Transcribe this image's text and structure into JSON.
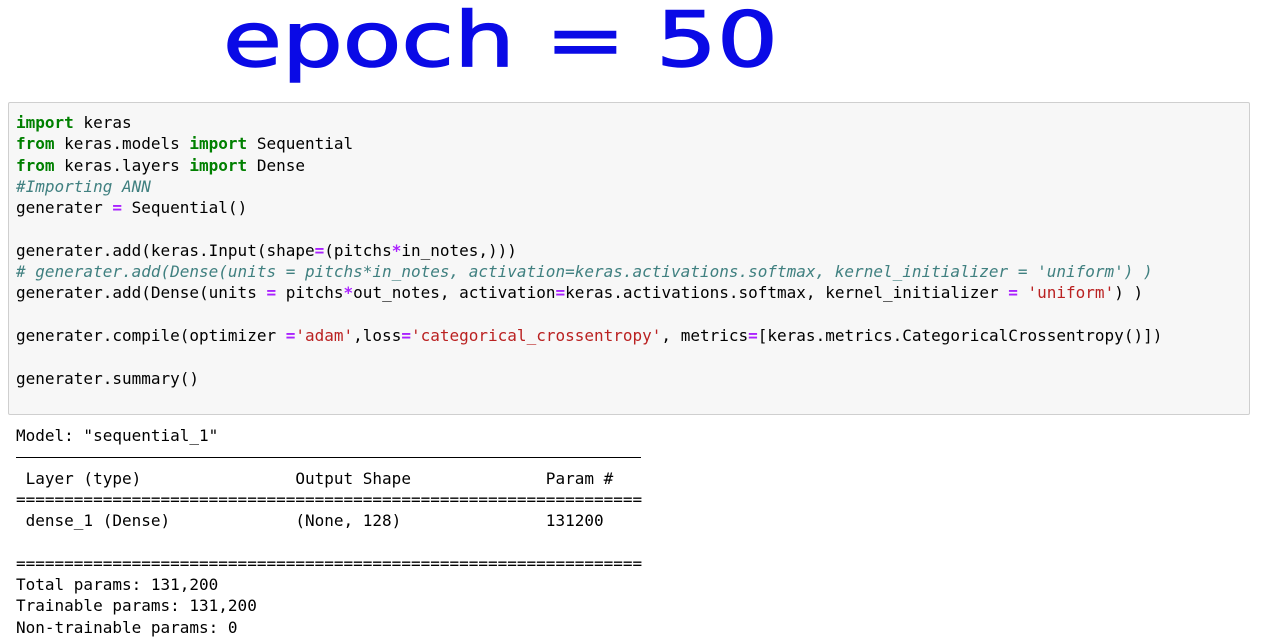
{
  "annotation": {
    "handwritten_text": "epoch = 50"
  },
  "code_cell": {
    "lines": [
      [
        {
          "t": "kw",
          "v": "import"
        },
        {
          "t": "n",
          "v": " keras"
        }
      ],
      [
        {
          "t": "kw",
          "v": "from"
        },
        {
          "t": "n",
          "v": " keras.models "
        },
        {
          "t": "kw",
          "v": "import"
        },
        {
          "t": "n",
          "v": " Sequential"
        }
      ],
      [
        {
          "t": "kw",
          "v": "from"
        },
        {
          "t": "n",
          "v": " keras.layers "
        },
        {
          "t": "kw",
          "v": "import"
        },
        {
          "t": "n",
          "v": " Dense"
        }
      ],
      [
        {
          "t": "cm",
          "v": "#Importing ANN"
        }
      ],
      [
        {
          "t": "n",
          "v": "generater "
        },
        {
          "t": "op",
          "v": "="
        },
        {
          "t": "n",
          "v": " Sequential()"
        }
      ],
      [
        {
          "t": "n",
          "v": ""
        }
      ],
      [
        {
          "t": "n",
          "v": "generater.add(keras.Input(shape"
        },
        {
          "t": "op",
          "v": "="
        },
        {
          "t": "n",
          "v": "(pitchs"
        },
        {
          "t": "op",
          "v": "*"
        },
        {
          "t": "n",
          "v": "in_notes,)))"
        }
      ],
      [
        {
          "t": "cm",
          "v": "# generater.add(Dense(units = pitchs*in_notes, activation=keras.activations.softmax, kernel_initializer = 'uniform') )"
        }
      ],
      [
        {
          "t": "n",
          "v": "generater.add(Dense(units "
        },
        {
          "t": "op",
          "v": "="
        },
        {
          "t": "n",
          "v": " pitchs"
        },
        {
          "t": "op",
          "v": "*"
        },
        {
          "t": "n",
          "v": "out_notes, activation"
        },
        {
          "t": "op",
          "v": "="
        },
        {
          "t": "n",
          "v": "keras.activations.softmax, kernel_initializer "
        },
        {
          "t": "op",
          "v": "="
        },
        {
          "t": "n",
          "v": " "
        },
        {
          "t": "st",
          "v": "'uniform'"
        },
        {
          "t": "n",
          "v": ") )"
        }
      ],
      [
        {
          "t": "n",
          "v": ""
        }
      ],
      [
        {
          "t": "n",
          "v": "generater.compile(optimizer "
        },
        {
          "t": "op",
          "v": "="
        },
        {
          "t": "st",
          "v": "'adam'"
        },
        {
          "t": "n",
          "v": ",loss"
        },
        {
          "t": "op",
          "v": "="
        },
        {
          "t": "st",
          "v": "'categorical_crossentropy'"
        },
        {
          "t": "n",
          "v": ", metrics"
        },
        {
          "t": "op",
          "v": "="
        },
        {
          "t": "n",
          "v": "[keras.metrics.CategoricalCrossentropy()])"
        }
      ],
      [
        {
          "t": "n",
          "v": ""
        }
      ],
      [
        {
          "t": "n",
          "v": "generater.summary()"
        }
      ]
    ]
  },
  "output": {
    "model_line": "Model: \"sequential_1\"",
    "header": " Layer (type)                Output Shape              Param #   ",
    "double_rule_1": "=================================================================",
    "row": " dense_1 (Dense)             (None, 128)               131200    ",
    "double_rule_2": "=================================================================",
    "total": "Total params: 131,200",
    "trainable": "Trainable params: 131,200",
    "non_trainable": "Non-trainable params: 0"
  }
}
